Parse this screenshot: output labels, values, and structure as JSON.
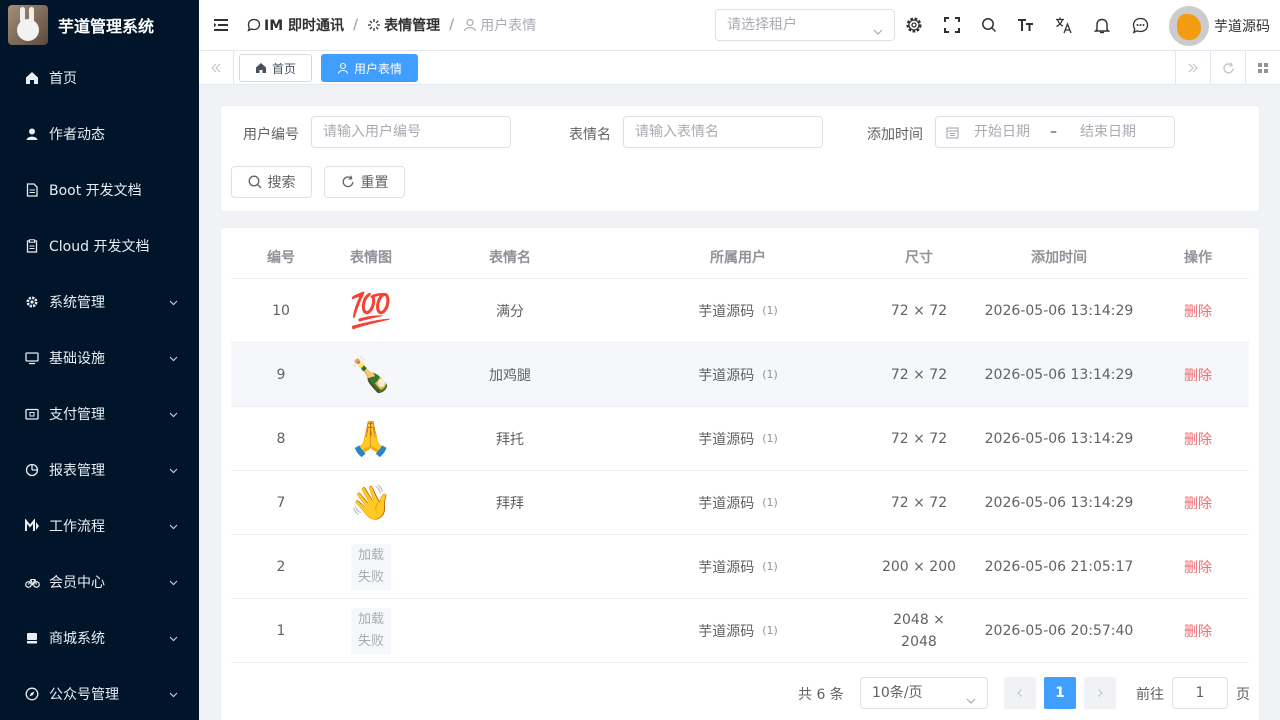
{
  "app": {
    "title": "芋道管理系统"
  },
  "sidebar": {
    "items": [
      {
        "label": "首页",
        "icon": "home-icon",
        "has_children": false
      },
      {
        "label": "作者动态",
        "icon": "user-icon",
        "has_children": false
      },
      {
        "label": "Boot 开发文档",
        "icon": "document-icon",
        "has_children": false
      },
      {
        "label": "Cloud 开发文档",
        "icon": "document-icon",
        "has_children": false
      },
      {
        "label": "系统管理",
        "icon": "gear-icon",
        "has_children": true
      },
      {
        "label": "基础设施",
        "icon": "monitor-icon",
        "has_children": true
      },
      {
        "label": "支付管理",
        "icon": "wallet-icon",
        "has_children": true
      },
      {
        "label": "报表管理",
        "icon": "pie-chart-icon",
        "has_children": true
      },
      {
        "label": "工作流程",
        "icon": "workflow-icon",
        "has_children": true
      },
      {
        "label": "会员中心",
        "icon": "bicycle-icon",
        "has_children": true
      },
      {
        "label": "商城系统",
        "icon": "shop-icon",
        "has_children": true
      },
      {
        "label": "公众号管理",
        "icon": "compass-icon",
        "has_children": true
      }
    ]
  },
  "header": {
    "breadcrumb": [
      {
        "label": "IM 即时通讯",
        "icon": "chat-icon"
      },
      {
        "label": "表情管理",
        "icon": "sparkle-icon"
      },
      {
        "label": "用户表情",
        "icon": "user-icon"
      }
    ],
    "tenant_placeholder": "请选择租户",
    "user_name": "芋道源码"
  },
  "tags": [
    {
      "label": "首页",
      "icon": "home-icon",
      "active": false
    },
    {
      "label": "用户表情",
      "icon": "user-icon",
      "active": true
    }
  ],
  "filters": {
    "user_id": {
      "label": "用户编号",
      "placeholder": "请输入用户编号"
    },
    "name": {
      "label": "表情名",
      "placeholder": "请输入表情名"
    },
    "time": {
      "label": "添加时间",
      "start_placeholder": "开始日期",
      "separator": "–",
      "end_placeholder": "结束日期"
    },
    "search_label": "搜索",
    "reset_label": "重置"
  },
  "table": {
    "columns": [
      "编号",
      "表情图",
      "表情名",
      "所属用户",
      "尺寸",
      "添加时间",
      "操作"
    ],
    "rows": [
      {
        "id": "10",
        "image": "💯",
        "name": "满分",
        "user": "芋道源码",
        "user_count": "(1)",
        "size": "72 × 72",
        "time": "2026-05-06 13:14:29",
        "action": "删除"
      },
      {
        "id": "9",
        "image": "🍾",
        "name": "加鸡腿",
        "user": "芋道源码",
        "user_count": "(1)",
        "size": "72 × 72",
        "time": "2026-05-06 13:14:29",
        "action": "删除"
      },
      {
        "id": "8",
        "image": "🙏",
        "name": "拜托",
        "user": "芋道源码",
        "user_count": "(1)",
        "size": "72 × 72",
        "time": "2026-05-06 13:14:29",
        "action": "删除"
      },
      {
        "id": "7",
        "image": "👋",
        "name": "拜拜",
        "user": "芋道源码",
        "user_count": "(1)",
        "size": "72 × 72",
        "time": "2026-05-06 13:14:29",
        "action": "删除"
      },
      {
        "id": "2",
        "image_error": [
          "加载",
          "失败"
        ],
        "name": "",
        "user": "芋道源码",
        "user_count": "(1)",
        "size": "200 × 200",
        "time": "2026-05-06 21:05:17",
        "action": "删除"
      },
      {
        "id": "1",
        "image_error": [
          "加载",
          "失败"
        ],
        "name": "",
        "user": "芋道源码",
        "user_count": "(1)",
        "size_lines": [
          "2048 ×",
          "2048"
        ],
        "time": "2026-05-06 20:57:40",
        "action": "删除"
      }
    ]
  },
  "pagination": {
    "total": "共 6 条",
    "page_size": "10条/页",
    "current_page": "1",
    "goto_label": "前往",
    "goto_value": "1",
    "page_suffix": "页"
  },
  "colors": {
    "sidebar_bg": "#001529",
    "primary": "#409eff",
    "danger": "#f56c6c"
  }
}
